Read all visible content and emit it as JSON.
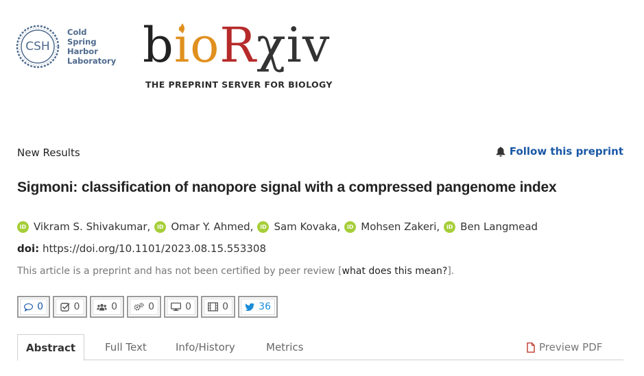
{
  "header": {
    "csh_abbrev": "CSH",
    "csh_name_lines": [
      "Cold",
      "Spring",
      "Harbor",
      "Laboratory"
    ],
    "site_name_parts": {
      "b": "b",
      "io": "io",
      "r": "R",
      "xiv": "χiv"
    },
    "tagline": "THE PREPRINT SERVER FOR BIOLOGY"
  },
  "article": {
    "category": "New Results",
    "follow_label": "Follow this preprint",
    "title": "Sigmoni: classification of nanopore signal with a compressed pangenome index",
    "authors": [
      "Vikram S. Shivakumar,",
      "Omar Y. Ahmed,",
      "Sam Kovaka,",
      "Mohsen Zakeri,",
      "Ben Langmead"
    ],
    "orcid_label": "iD",
    "doi_label": "doi:",
    "doi_value": "https://doi.org/10.1101/2023.08.15.553308",
    "notice_text": "This article is a preprint and has not been certified by peer review [",
    "notice_link": "what does this mean?",
    "notice_end": "]."
  },
  "metrics": {
    "comments": "0",
    "reviews": "0",
    "community": "0",
    "automated": "0",
    "tv": "0",
    "video": "0",
    "twitter": "36"
  },
  "tabs": {
    "abstract": "Abstract",
    "full_text": "Full Text",
    "info_history": "Info/History",
    "metrics": "Metrics",
    "preview_pdf": "Preview PDF"
  },
  "colors": {
    "link_blue": "#1a58a6",
    "orcid_green": "#a6ce39",
    "biorxiv_orange": "#e0901e",
    "biorxiv_red": "#b62a2a",
    "csh_blue": "#4f6a8e",
    "twitter_blue": "#1a8cd8"
  }
}
